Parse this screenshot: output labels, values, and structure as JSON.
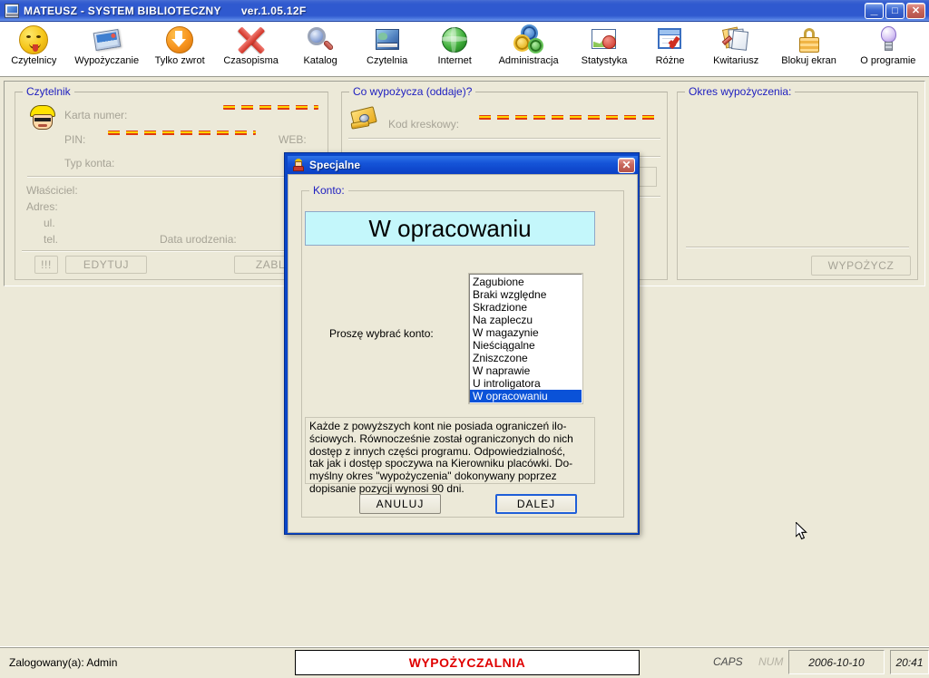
{
  "window": {
    "title": "MATEUSZ - SYSTEM BIBLIOTECZNY",
    "version": "ver.1.05.12F",
    "icon": "app-window-icon",
    "controls": {
      "minimize": "_",
      "maximize": "□",
      "close": "✕"
    }
  },
  "toolbar": {
    "items": [
      {
        "label": "Czytelnicy",
        "icon": "smiley-face-icon"
      },
      {
        "label": "Wypożyczanie",
        "icon": "photo-card-icon"
      },
      {
        "label": "Tylko zwrot",
        "icon": "orange-down-arrow-icon"
      },
      {
        "label": "Czasopisma",
        "icon": "red-x-icon"
      },
      {
        "label": "Katalog",
        "icon": "magnifier-icon"
      },
      {
        "label": "Czytelnia",
        "icon": "reading-room-icon"
      },
      {
        "label": "Internet",
        "icon": "green-globe-icon"
      },
      {
        "label": "Administracja",
        "icon": "gears-icon"
      },
      {
        "label": "Statystyka",
        "icon": "chart-icon"
      },
      {
        "label": "Różne",
        "icon": "calendar-check-icon"
      },
      {
        "label": "Kwitariusz",
        "icon": "receipts-icon"
      },
      {
        "label": "Blokuj ekran",
        "icon": "padlock-icon"
      },
      {
        "label": "O programie",
        "icon": "lightbulb-icon"
      }
    ]
  },
  "form": {
    "reader_group": {
      "caption": "Czytelnik",
      "avatar_icon": "reader-avatar-icon",
      "labels": {
        "card_number": "Karta numer:",
        "pin": "PIN:",
        "web": "WEB:",
        "account_type": "Typ konta:",
        "owner": "Właściciel:",
        "address": "Adres:",
        "street": "ul.",
        "phone": "tel.",
        "birth_date": "Data urodzenia:"
      },
      "buttons": {
        "alert": "!!!",
        "edit": "EDYTUJ",
        "block": "ZABLO"
      }
    },
    "borrow_group": {
      "caption": "Co wypożycza (oddaje)?",
      "scanner_icon": "barcode-scanner-icon",
      "barcode_label": "Kod kreskowy:"
    },
    "period_group": {
      "caption": "Okres wypożyczenia:",
      "lend_button": "WYPOŻYCZ"
    }
  },
  "dialog": {
    "title": "Specjalne",
    "icon": "person-icon",
    "close": "✕",
    "group_caption": "Konto:",
    "selected_account": "W opracowaniu",
    "prompt": "Proszę wybrać konto:",
    "accounts": [
      "Zagubione",
      "Braki względne",
      "Skradzione",
      "Na zapleczu",
      "W magazynie",
      "Nieściągalne",
      "Zniszczone",
      "W naprawie",
      "U introligatora",
      "W opracowaniu"
    ],
    "selected_index": 9,
    "description": "Każde z powyższych kont nie posiada ograniczeń ilo-\nściowych. Równocześnie został ograniczonych do nich\ndostęp z innych części programu. Odpowiedzialność,\ntak jak i dostęp spoczywa na Kierowniku placówki. Do-\nmyślny okres \"wypożyczenia\" dokonywany poprzez\ndopisanie pozycji wynosi 90 dni.",
    "buttons": {
      "cancel": "ANULUJ",
      "next": "DALEJ"
    }
  },
  "statusbar": {
    "user": "Zalogowany(a): Admin",
    "mode": "WYPOŻYCZALNIA",
    "caps": "CAPS",
    "num": "NUM",
    "date": "2006-10-10",
    "time": "20:41"
  },
  "colors": {
    "titlebar_blue": "#2f59cf",
    "dialog_blue": "#0a46c8",
    "face": "#ece9d8",
    "group_caption": "#2020c0",
    "selection": "#0a52d8",
    "account_display_bg": "#c4f7fb",
    "mode_red": "#e00000",
    "dash_red": "#e03a10"
  }
}
